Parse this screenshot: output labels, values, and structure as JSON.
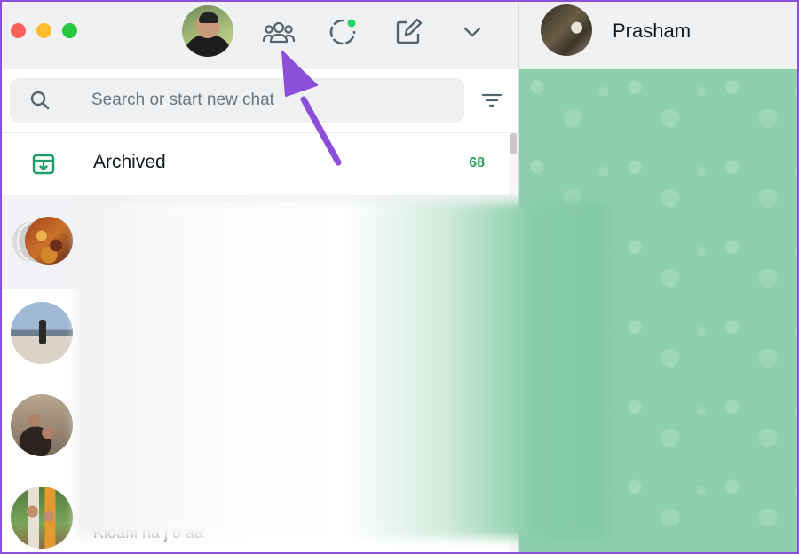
{
  "header": {
    "community_icon": "community-icon",
    "status_icon": "status-icon",
    "new_chat_icon": "compose-icon",
    "menu_icon": "chevron-down-icon"
  },
  "search": {
    "placeholder": "Search or start new chat",
    "value": ""
  },
  "archived": {
    "label": "Archived",
    "count": "68"
  },
  "chats": [
    {
      "preview": ""
    },
    {
      "preview": ""
    },
    {
      "preview": ""
    },
    {
      "preview": "Kidani na j o aa"
    }
  ],
  "conversation": {
    "contact_name": "Prasham"
  },
  "colors": {
    "accent_green": "#25a45d",
    "annotation_arrow": "#8c4fd8",
    "wallpaper": "#8ecfae"
  }
}
